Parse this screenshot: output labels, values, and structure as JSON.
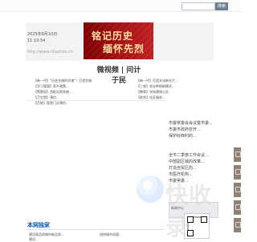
{
  "topbar": {
    "search_placeholder": "",
    "search_button": "搜索"
  },
  "header": {
    "date": "2025年8月10日",
    "time": "11:10:54",
    "url": "http://www.chazhou.cn"
  },
  "banner": {
    "title_line1": "铭记历史",
    "title_line2": "缅怀先烈"
  },
  "video": {
    "heading": "微视频 | 问计于民"
  },
  "news": {
    "left": [
      "【新一代】“历史名城的灵魂”！打造名城",
      "【学习强国】家乡政策...",
      "【警察局】首批证照系统...",
      "【卫生院】预约...",
      "【百姓】医院门诊预约..."
    ],
    "right": [
      "【新一代】打造文化新名片...",
      "【三农】农业种植新模式...",
      "【教育】学校通知公告",
      "【综合】社区服务..."
    ]
  },
  "sidebar": {
    "items": [
      "市委常委会会议暨市委...",
      "市委市政府召开...",
      "保护好西村的...",
      "全市二季度工作会议...",
      "中部副区域的改革...",
      "打造自贸区的...",
      "市医疗机构...",
      "市委常委..."
    ],
    "block_text": "新闻中心"
  },
  "section": {
    "title": "本网独家",
    "items": [
      "建设高品质城市新品质...",
      "加快城市治理...",
      "建设..."
    ]
  },
  "watermark": {
    "text": "快收录"
  },
  "qrcode": {
    "label": ""
  }
}
